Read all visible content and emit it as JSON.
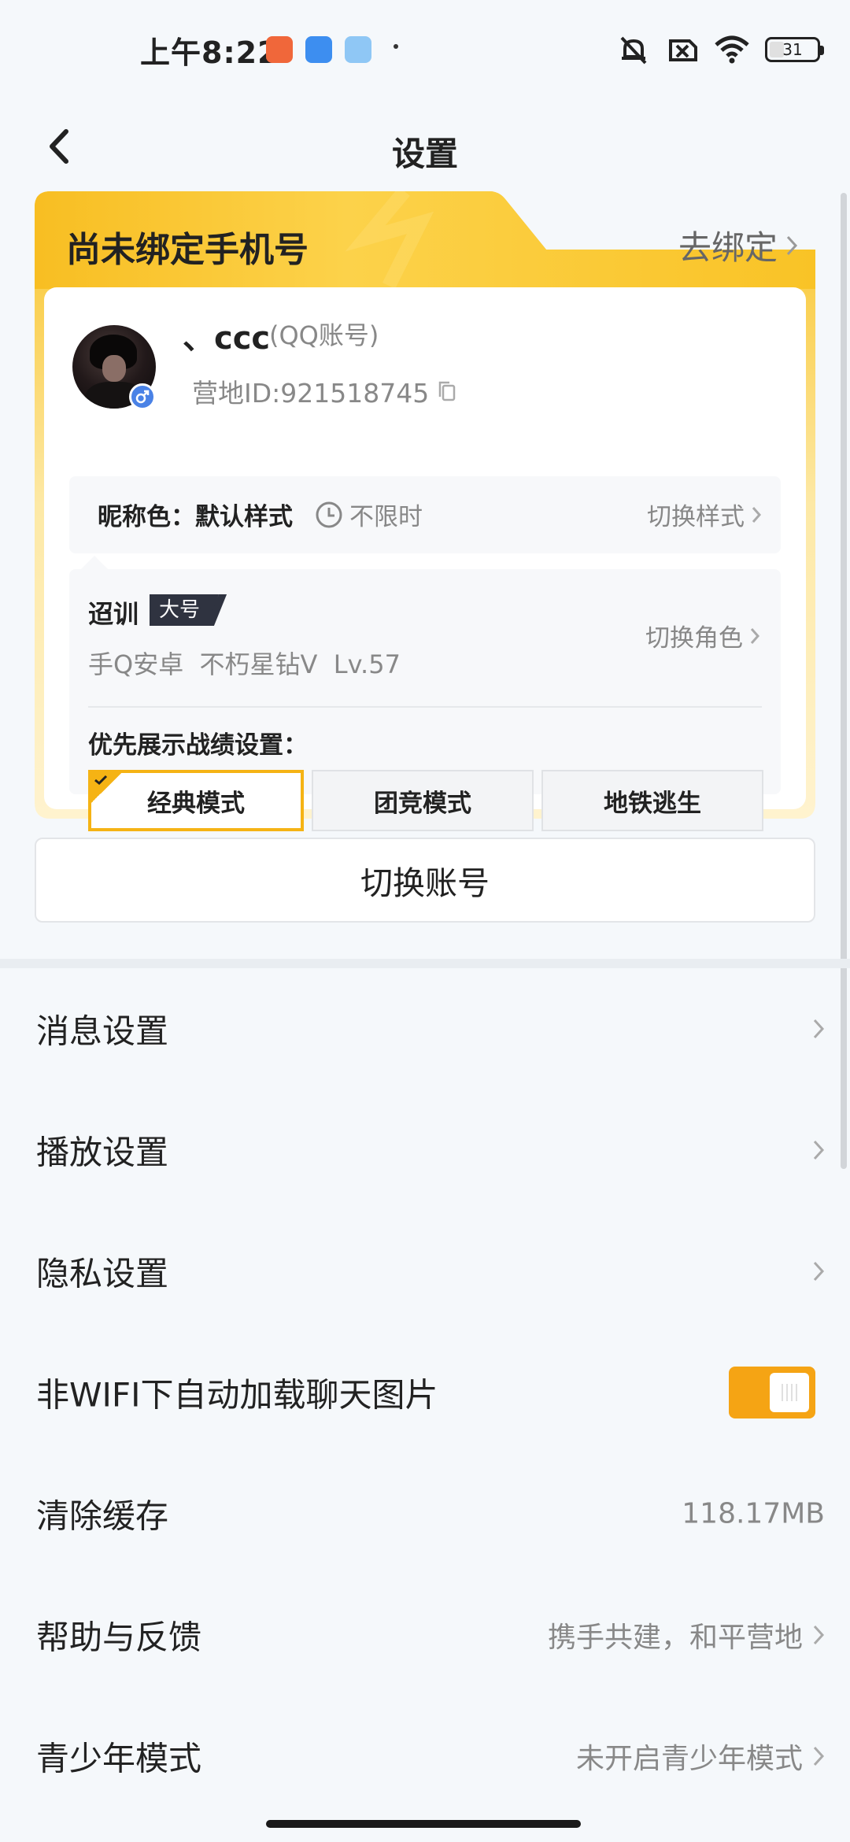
{
  "status_bar": {
    "time": "上午8:22",
    "battery": "31"
  },
  "header": {
    "title": "设置"
  },
  "account_card": {
    "bind_notice": "尚未绑定手机号",
    "bind_link": "去绑定",
    "nickname": "、ccc",
    "account_type": "(QQ账号)",
    "camp_id": "营地ID:921518745",
    "nick_color_label": "昵称色：默认样式",
    "nick_color_limit": "不限时",
    "switch_style": "切换样式",
    "role_name": "迢训",
    "role_badge": "大号",
    "role_info": "手Q安卓  不朽星钻V  Lv.57",
    "switch_role": "切换角色",
    "preference_label": "优先展示战绩设置：",
    "modes": [
      {
        "label": "经典模式",
        "selected": true
      },
      {
        "label": "团竞模式",
        "selected": false
      },
      {
        "label": "地铁逃生",
        "selected": false
      }
    ],
    "accent_color": "#f5b314"
  },
  "switch_account_label": "切换账号",
  "settings": [
    {
      "label": "消息设置",
      "value": "",
      "control": "chevron"
    },
    {
      "label": "播放设置",
      "value": "",
      "control": "chevron"
    },
    {
      "label": "隐私设置",
      "value": "",
      "control": "chevron"
    },
    {
      "label": "非WIFI下自动加载聊天图片",
      "value": "",
      "control": "toggle",
      "on": true
    },
    {
      "label": "清除缓存",
      "value": "118.17MB",
      "control": "none"
    },
    {
      "label": "帮助与反馈",
      "value": "携手共建，和平营地",
      "control": "chevron"
    },
    {
      "label": "青少年模式",
      "value": "未开启青少年模式",
      "control": "chevron"
    }
  ]
}
